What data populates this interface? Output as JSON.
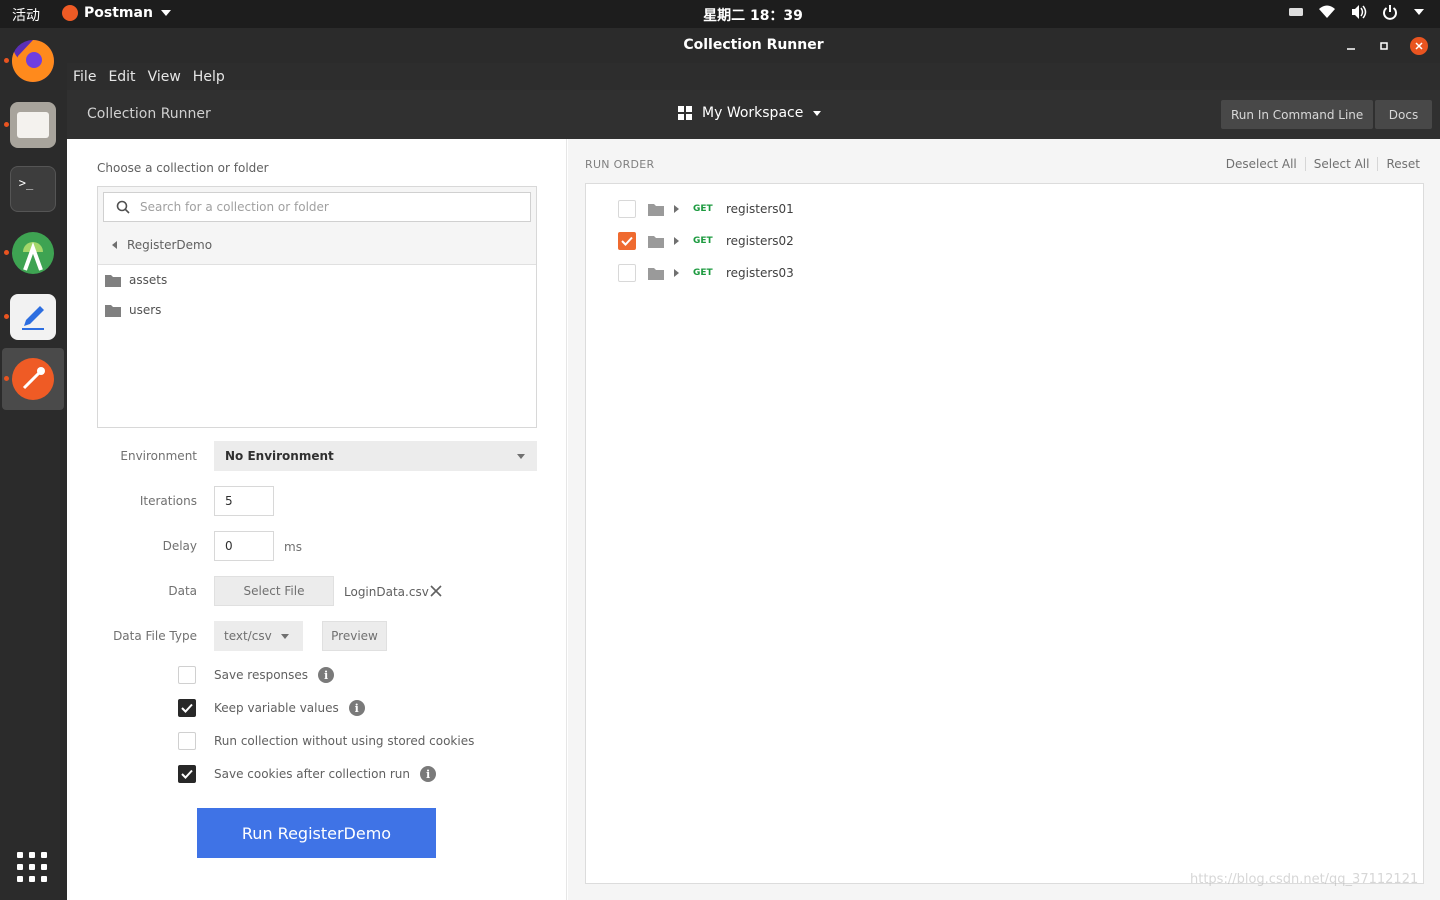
{
  "os_topbar": {
    "activities": "活动",
    "app_name": "Postman",
    "clock": "星期二 18：39"
  },
  "window": {
    "title": "Collection Runner"
  },
  "menu": {
    "items": [
      "File",
      "Edit",
      "View",
      "Help"
    ]
  },
  "header": {
    "title": "Collection Runner",
    "workspace": "My Workspace",
    "run_cli": "Run In Command Line",
    "docs": "Docs"
  },
  "left": {
    "choose_label": "Choose a collection or folder",
    "search_placeholder": "Search for a collection or folder",
    "breadcrumb": "RegisterDemo",
    "folders": [
      "assets",
      "users"
    ],
    "environment_label": "Environment",
    "environment_value": "No Environment",
    "iterations_label": "Iterations",
    "iterations_value": "5",
    "delay_label": "Delay",
    "delay_value": "0",
    "delay_unit": "ms",
    "data_label": "Data",
    "select_file": "Select File",
    "data_filename": "LoginData.csv",
    "data_file_type_label": "Data File Type",
    "data_file_type": "text/csv",
    "preview": "Preview",
    "options": [
      {
        "label": "Save responses",
        "checked": false,
        "info": true
      },
      {
        "label": "Keep variable values",
        "checked": true,
        "info": true
      },
      {
        "label": "Run collection without using stored cookies",
        "checked": false,
        "info": false
      },
      {
        "label": "Save cookies after collection run",
        "checked": true,
        "info": true
      }
    ],
    "run_button": "Run RegisterDemo"
  },
  "right": {
    "run_order_label": "RUN ORDER",
    "deselect_all": "Deselect All",
    "select_all": "Select All",
    "reset": "Reset",
    "requests": [
      {
        "method": "GET",
        "name": "registers01",
        "checked": false
      },
      {
        "method": "GET",
        "name": "registers02",
        "checked": true
      },
      {
        "method": "GET",
        "name": "registers03",
        "checked": false
      }
    ]
  },
  "watermark": "https://blog.csdn.net/qq_37112121",
  "colors": {
    "accent_orange": "#ef6a2f",
    "run_button_blue": "#3f73e6",
    "get_method_green": "#1c9a3f"
  },
  "dock_icons": [
    "firefox-icon",
    "files-icon",
    "terminal-icon",
    "android-studio-icon",
    "text-editor-icon",
    "postman-icon",
    "show-apps-icon"
  ]
}
